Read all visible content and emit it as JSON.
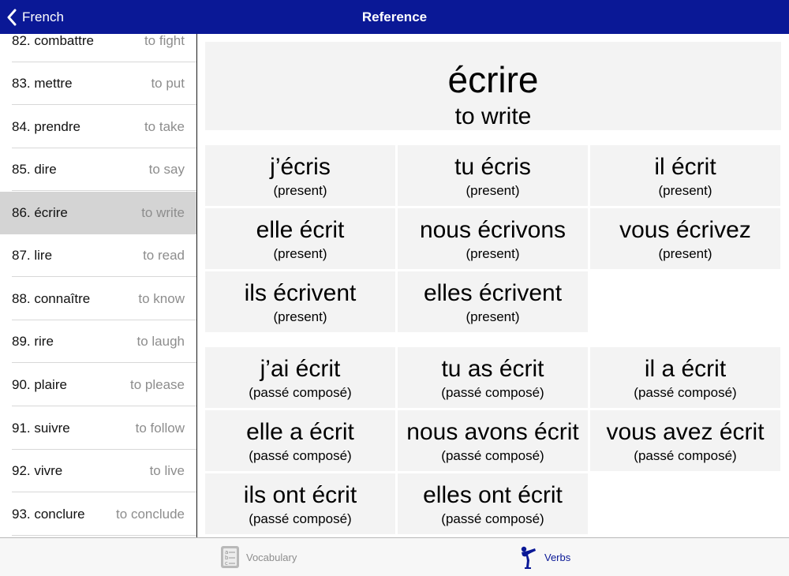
{
  "nav": {
    "back_label": "French",
    "title": "Reference"
  },
  "sidebar": {
    "items": [
      {
        "word": "82. combattre",
        "translation": "to fight"
      },
      {
        "word": "83. mettre",
        "translation": "to put"
      },
      {
        "word": "84. prendre",
        "translation": "to take"
      },
      {
        "word": "85. dire",
        "translation": "to say"
      },
      {
        "word": "86. écrire",
        "translation": "to write",
        "selected": true
      },
      {
        "word": "87. lire",
        "translation": "to read"
      },
      {
        "word": "88. connaître",
        "translation": "to know"
      },
      {
        "word": "89. rire",
        "translation": "to laugh"
      },
      {
        "word": "90. plaire",
        "translation": "to please"
      },
      {
        "word": "91. suivre",
        "translation": "to follow"
      },
      {
        "word": "92. vivre",
        "translation": "to live"
      },
      {
        "word": "93. conclure",
        "translation": "to conclude"
      }
    ]
  },
  "main": {
    "verb": "écrire",
    "verb_translation": "to write",
    "present": [
      {
        "form": "j’écris",
        "tense": "(present)"
      },
      {
        "form": "tu écris",
        "tense": "(present)"
      },
      {
        "form": "il écrit",
        "tense": "(present)"
      },
      {
        "form": "elle écrit",
        "tense": "(present)"
      },
      {
        "form": "nous écrivons",
        "tense": "(present)"
      },
      {
        "form": "vous écrivez",
        "tense": "(present)"
      },
      {
        "form": "ils écrivent",
        "tense": "(present)"
      },
      {
        "form": "elles écrivent",
        "tense": "(present)"
      }
    ],
    "passe_compose": [
      {
        "form": "j’ai écrit",
        "tense": "(passé composé)"
      },
      {
        "form": "tu as écrit",
        "tense": "(passé composé)"
      },
      {
        "form": "il a écrit",
        "tense": "(passé composé)"
      },
      {
        "form": "elle a écrit",
        "tense": "(passé composé)"
      },
      {
        "form": "nous avons écrit",
        "tense": "(passé composé)"
      },
      {
        "form": "vous avez écrit",
        "tense": "(passé composé)"
      },
      {
        "form": "ils ont écrit",
        "tense": "(passé composé)"
      },
      {
        "form": "elles ont écrit",
        "tense": "(passé composé)"
      }
    ]
  },
  "tabbar": {
    "vocabulary": {
      "label": "Vocabulary",
      "icon": "vocabulary-cards-icon"
    },
    "verbs": {
      "label": "Verbs",
      "icon": "verbs-figure-icon"
    }
  },
  "colors": {
    "nav_background": "#0a1896",
    "accent": "#0a1896",
    "selected_row": "#d4d4d4",
    "card": "#f3f3f3"
  }
}
